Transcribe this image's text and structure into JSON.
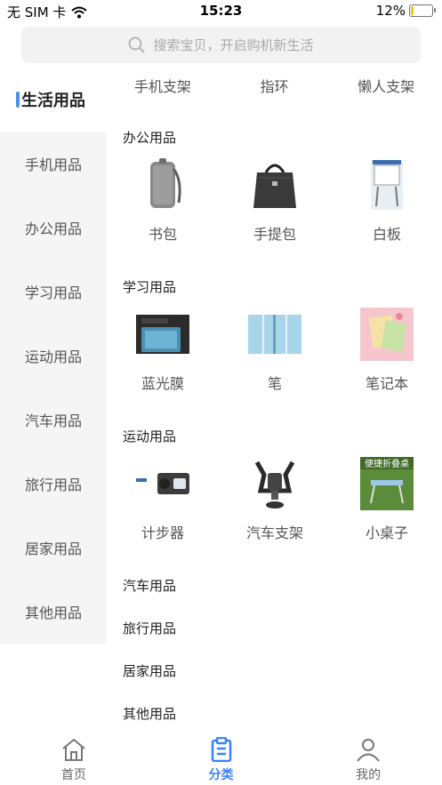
{
  "status_bar": {
    "carrier": "无 SIM 卡",
    "time": "15:23",
    "battery": "12%",
    "battery_level": 0.12
  },
  "search": {
    "placeholder": "搜索宝贝，开启购机新生活"
  },
  "sidebar": {
    "items": [
      {
        "label": "生活用品",
        "active": true
      },
      {
        "label": "手机用品"
      },
      {
        "label": "办公用品"
      },
      {
        "label": "学习用品"
      },
      {
        "label": "运动用品"
      },
      {
        "label": "汽车用品"
      },
      {
        "label": "旅行用品"
      },
      {
        "label": "居家用品"
      },
      {
        "label": "其他用品"
      }
    ]
  },
  "content": {
    "top_row": [
      "手机支架",
      "指环",
      "懒人支架"
    ],
    "sections": [
      {
        "title": "办公用品",
        "items": [
          {
            "label": "书包",
            "icon": "backpack-image"
          },
          {
            "label": "手提包",
            "icon": "tote-bag-image"
          },
          {
            "label": "白板",
            "icon": "whiteboard-image"
          }
        ]
      },
      {
        "title": "学习用品",
        "items": [
          {
            "label": "蓝光膜",
            "icon": "screen-film-image"
          },
          {
            "label": "笔",
            "icon": "pen-image"
          },
          {
            "label": "笔记本",
            "icon": "notebook-image"
          }
        ]
      },
      {
        "title": "运动用品",
        "items": [
          {
            "label": "计步器",
            "icon": "pedometer-image"
          },
          {
            "label": "汽车支架",
            "icon": "car-mount-image"
          },
          {
            "label": "小桌子",
            "icon": "folding-table-image",
            "banner": "便捷折叠桌"
          }
        ]
      },
      {
        "title": "汽车用品"
      },
      {
        "title": "旅行用品"
      },
      {
        "title": "居家用品"
      },
      {
        "title": "其他用品"
      }
    ]
  },
  "tab_bar": {
    "tabs": [
      {
        "label": "首页",
        "icon": "home-icon"
      },
      {
        "label": "分类",
        "icon": "clipboard-icon",
        "active": true
      },
      {
        "label": "我的",
        "icon": "person-icon"
      }
    ]
  },
  "colors": {
    "accent": "#4a90e2",
    "tab_active": "#3b82f6",
    "sidebar_bg": "#f5f5f5",
    "search_bg": "#f2f2f2"
  }
}
